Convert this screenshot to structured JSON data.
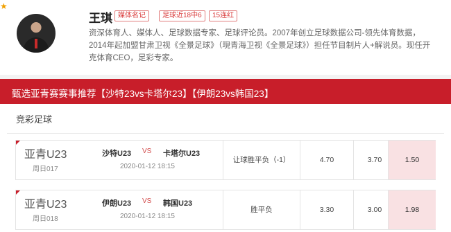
{
  "expert": {
    "name": "王琪",
    "badges": [
      "媒体名记",
      "足球近18中6",
      "15连红"
    ],
    "bio": "资深体育人、媒体人、足球数据专家、足球评论员。2007年创立足球数据公司-领先体育数据，2014年起加盟甘肃卫视《全景足球》（現青海卫视《全景足球》）担任节目制片人+解说员。现任开克体育CEO，足彩专家。"
  },
  "banner": {
    "title": "甄选亚青赛赛事推荐【沙特23vs卡塔尔23】【伊朗23vs韩国23】"
  },
  "section": {
    "title": "竞彩足球"
  },
  "matches": [
    {
      "league": "亚青U23",
      "day": "周日017",
      "home": "沙特U23",
      "vs": "VS",
      "away": "卡塔尔U23",
      "time": "2020-01-12 18:15",
      "play_type": "让球胜平负（-1）",
      "odds": [
        "4.70",
        "3.70",
        "1.50"
      ]
    },
    {
      "league": "亚青U23",
      "day": "周日018",
      "home": "伊朗U23",
      "vs": "VS",
      "away": "韩国U23",
      "time": "2020-01-12 18:15",
      "play_type": "胜平负",
      "odds": [
        "3.30",
        "3.00",
        "1.98"
      ]
    }
  ],
  "colors": {
    "accent": "#c81e2a",
    "highlight": "#f9e1e3"
  }
}
